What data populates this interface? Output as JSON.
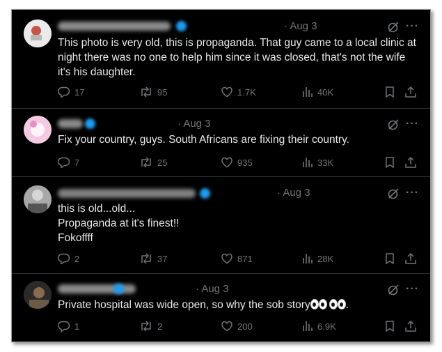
{
  "posts": [
    {
      "date": "· Aug 3",
      "text_lines": [
        "This photo is very old, this is propaganda. That guy came to a local clinic at",
        "night there was no one to help him since it was closed, that's not the wife",
        "it's his daughter."
      ],
      "replies": "17",
      "reposts": "95",
      "likes": "1.7K",
      "views": "40K"
    },
    {
      "date": "· Aug 3",
      "text_lines": [
        "Fix your country, guys. South Africans are fixing their country."
      ],
      "replies": "7",
      "reposts": "25",
      "likes": "935",
      "views": "33K"
    },
    {
      "date": "· Aug 3",
      "text_lines": [
        "this is old...old...",
        "Propaganda at it's finest!!",
        "Fokoffff"
      ],
      "replies": "2",
      "reposts": "37",
      "likes": "871",
      "views": "28K"
    },
    {
      "date": "· Aug 3",
      "text_lines": [
        "Private hospital was wide open, so why the sob story"
      ],
      "emoji": "👀👀",
      "text_end": ".",
      "replies": "1",
      "reposts": "2",
      "likes": "200",
      "views": "6.9K"
    }
  ],
  "icons": {
    "reply": "reply-icon",
    "repost": "repost-icon",
    "like": "heart-icon",
    "views": "views-icon",
    "bookmark": "bookmark-icon",
    "share": "share-icon",
    "grok": "grok-icon",
    "more": "more-icon"
  },
  "colors": {
    "background": "#000000",
    "text": "#e7e9ea",
    "muted": "#71767b",
    "verified": "#1d9bf0"
  }
}
